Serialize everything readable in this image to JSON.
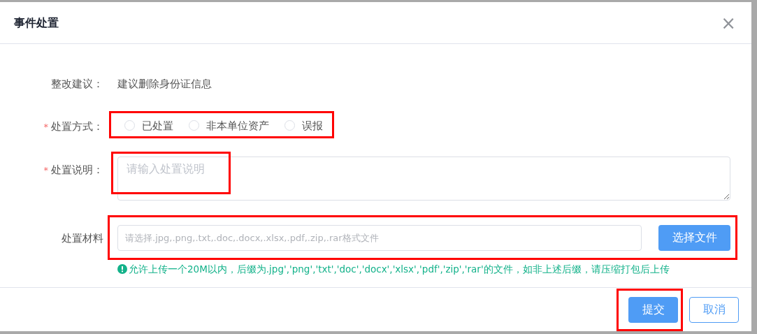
{
  "dialog": {
    "title": "事件处置",
    "close": "×"
  },
  "form": [
    {
      "kind": "text",
      "label": "整改建议：",
      "value": "建议删除身份证信息"
    },
    {
      "kind": "radio",
      "label": "处置方式：",
      "required_marker": "*",
      "highlighted": true,
      "options": [
        {
          "label": "已处置",
          "selected": false
        },
        {
          "label": "非本单位资产",
          "selected": false
        },
        {
          "label": "误报",
          "selected": false
        }
      ]
    },
    {
      "kind": "textarea",
      "label": "处置说明：",
      "required_marker": "*",
      "highlighted": true,
      "placeholder": "请输入处置说明"
    },
    {
      "kind": "file",
      "label": "处置材料",
      "highlighted": true,
      "placeholder": "请选择.jpg,.png,.txt,.doc,.docx,.xlsx,.pdf,.zip,.rar格式文件",
      "button": "选择文件",
      "hint": "允许上传一个20M以内，后缀为.jpg','png','txt','doc','docx','xlsx','pdf','zip','rar'的文件，如非上述后缀，请压缩打包后上传"
    }
  ],
  "footer": [
    {
      "kind": "primary",
      "label": "提交",
      "highlighted": true
    },
    {
      "kind": "secondary",
      "label": "取消",
      "highlighted": false
    }
  ]
}
